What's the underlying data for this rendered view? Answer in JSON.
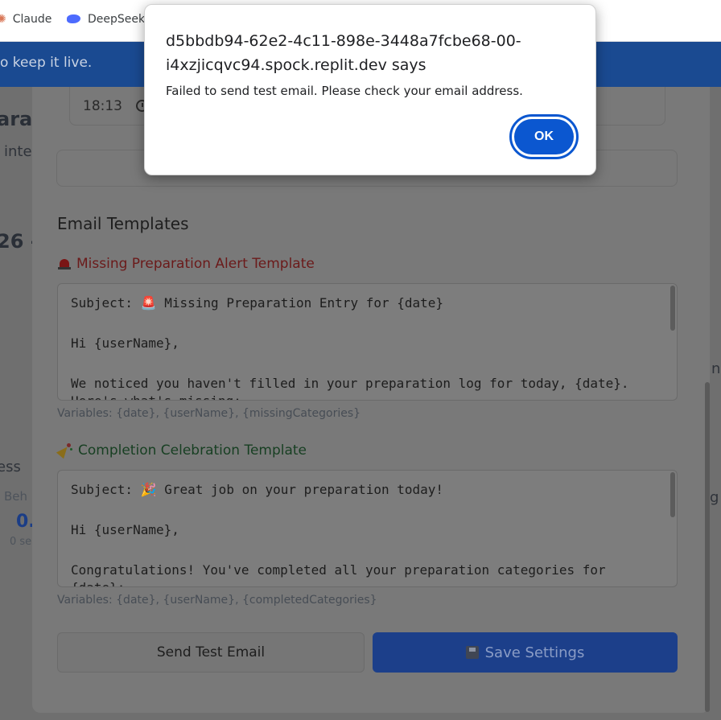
{
  "bookmarks": [
    {
      "label": "Claude",
      "icon": "claude-icon"
    },
    {
      "label": "DeepSeek",
      "icon": "deepseek-icon"
    }
  ],
  "banner": {
    "text": "o keep it live."
  },
  "background": {
    "frag_title": "ara",
    "frag_sub": "inte",
    "frag_date": "26 -",
    "frag_progress": "ess",
    "frag_beh": "Beh",
    "frag_val": "0.",
    "frag_small": "0 se",
    "frag_right1": "n",
    "frag_right2": "g"
  },
  "modal": {
    "time_value": "18:13",
    "section_title": "Email Templates",
    "missing_template": {
      "label": "Missing Preparation Alert Template",
      "lines": [
        "Subject: 🚨 Missing Preparation Entry for {date}",
        "",
        "Hi {userName},",
        "",
        "We noticed you haven't filled in your preparation log for today, {date}.",
        "Here's what's missing:"
      ],
      "variables": "Variables: {date}, {userName}, {missingCategories}"
    },
    "completion_template": {
      "label": "Completion Celebration Template",
      "lines": [
        "Subject: 🎉 Great job on your preparation today!",
        "",
        "Hi {userName},",
        "",
        "Congratulations! You've completed all your preparation categories for",
        "{date}:"
      ],
      "variables": "Variables: {date}, {userName}, {completedCategories}"
    },
    "send_test_label": "Send Test Email",
    "save_label": "Save Settings"
  },
  "alert": {
    "title": "d5bbdb94-62e2-4c11-898e-3448a7fcbe68-00-i4xzjicqvc94.spock.replit.dev says",
    "message": "Failed to send test email. Please check your email address.",
    "ok_label": "OK"
  }
}
